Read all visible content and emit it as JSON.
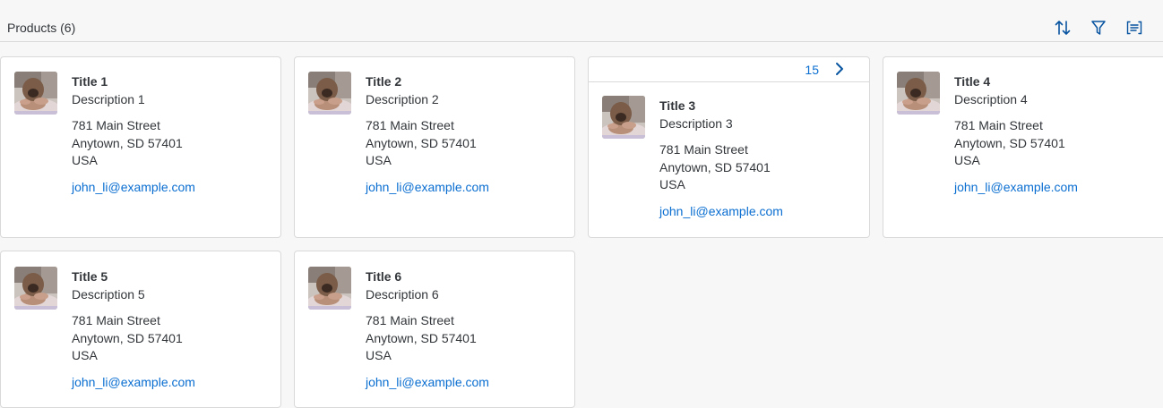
{
  "toolbar": {
    "title": "Products (6)",
    "icons": [
      "sort-icon",
      "filter-icon",
      "group-icon"
    ]
  },
  "cards": [
    {
      "title": "Title 1",
      "description": "Description 1",
      "street": "781 Main Street",
      "city": "Anytown, SD 57401",
      "country": "USA",
      "email": "john_li@example.com"
    },
    {
      "title": "Title 2",
      "description": "Description 2",
      "street": "781 Main Street",
      "city": "Anytown, SD 57401",
      "country": "USA",
      "email": "john_li@example.com"
    },
    {
      "title": "Title 3",
      "description": "Description 3",
      "street": "781 Main Street",
      "city": "Anytown, SD 57401",
      "country": "USA",
      "email": "john_li@example.com",
      "header_count": "15"
    },
    {
      "title": "Title 4",
      "description": "Description 4",
      "street": "781 Main Street",
      "city": "Anytown, SD 57401",
      "country": "USA",
      "email": "john_li@example.com"
    },
    {
      "title": "Title 5",
      "description": "Description 5",
      "street": "781 Main Street",
      "city": "Anytown, SD 57401",
      "country": "USA",
      "email": "john_li@example.com"
    },
    {
      "title": "Title 6",
      "description": "Description 6",
      "street": "781 Main Street",
      "city": "Anytown, SD 57401",
      "country": "USA",
      "email": "john_li@example.com"
    }
  ],
  "colors": {
    "accent": "#0a6ed1",
    "icon": "#0854a0",
    "text": "#32363a",
    "border": "#d9d9d9"
  }
}
